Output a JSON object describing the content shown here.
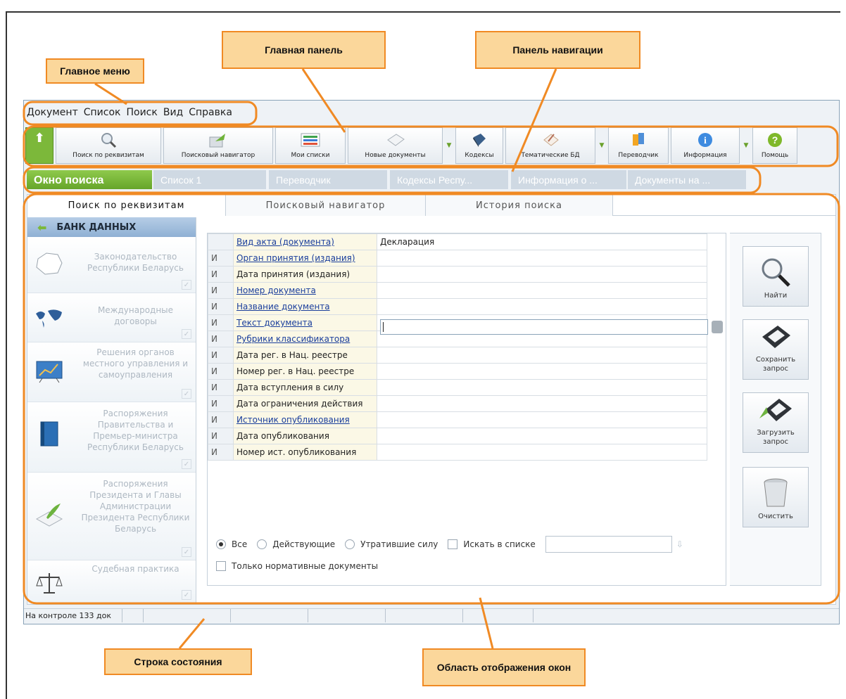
{
  "callouts": {
    "main_menu": "Главное меню",
    "main_panel": "Главная панель",
    "nav_panel": "Панель навигации",
    "status_bar": "Строка состояния",
    "window_area": "Область отображения окон"
  },
  "menu": [
    "Документ",
    "Список",
    "Поиск",
    "Вид",
    "Справка"
  ],
  "toolbar": [
    {
      "label": "Поиск по реквизитам",
      "icon": "magnifier-icon"
    },
    {
      "label": "Поисковый навигатор",
      "icon": "navigator-arrow-icon"
    },
    {
      "label": "Мои списки",
      "icon": "lists-icon"
    },
    {
      "label": "Новые документы",
      "icon": "new-documents-icon"
    },
    {
      "label": "Кодексы",
      "icon": "codex-book-icon"
    },
    {
      "label": "Тематические БД",
      "icon": "thematic-db-icon"
    },
    {
      "label": "Переводчик",
      "icon": "translator-icon"
    },
    {
      "label": "Информация",
      "icon": "info-icon"
    },
    {
      "label": "Помощь",
      "icon": "help-icon"
    }
  ],
  "window_tabs": [
    "Окно поиска",
    "Список 1",
    "Переводчик",
    "Кодексы Респу...",
    "Информация о ...",
    "Документы на ..."
  ],
  "search_tabs": [
    "Поиск по реквизитам",
    "Поисковый навигатор",
    "История поиска"
  ],
  "bank": {
    "title": "БАНК ДАННЫХ",
    "items": [
      "Законодательство Республики Беларусь",
      "Международные договоры",
      "Решения органов местного управления и самоуправления",
      "Распоряжения Правительства и Премьер-министра Республики Беларусь",
      "Распоряжения Президента и Главы Администрации Президента Республики Беларусь",
      "Судебная практика"
    ]
  },
  "requisites": [
    {
      "op": "",
      "name": "Вид акта (документа)",
      "value": "Декларация",
      "link": true
    },
    {
      "op": "И",
      "name": "Орган принятия (издания)",
      "value": "",
      "link": true
    },
    {
      "op": "И",
      "name": "Дата принятия (издания)",
      "value": "",
      "link": false
    },
    {
      "op": "И",
      "name": "Номер документа",
      "value": "",
      "link": true
    },
    {
      "op": "И",
      "name": "Название документа",
      "value": "",
      "link": true
    },
    {
      "op": "И",
      "name": "Текст документа",
      "value": "",
      "link": true
    },
    {
      "op": "И",
      "name": "Рубрики классификатора",
      "value": "",
      "link": true
    },
    {
      "op": "И",
      "name": "Дата рег. в Нац. реестре",
      "value": "",
      "link": false
    },
    {
      "op": "И",
      "name": "Номер рег. в Нац. реестре",
      "value": "",
      "link": false
    },
    {
      "op": "И",
      "name": "Дата вступления в силу",
      "value": "",
      "link": false
    },
    {
      "op": "И",
      "name": "Дата ограничения действия",
      "value": "",
      "link": false
    },
    {
      "op": "И",
      "name": "Источник опубликования",
      "value": "",
      "link": true
    },
    {
      "op": "И",
      "name": "Дата опубликования",
      "value": "",
      "link": false
    },
    {
      "op": "И",
      "name": "Номер ист. опубликования",
      "value": "",
      "link": false
    }
  ],
  "filters": {
    "all": "Все",
    "active": "Действующие",
    "expired": "Утратившие силу",
    "in_list": "Искать в списке",
    "normative_only": "Только нормативные документы"
  },
  "actions": {
    "find": "Найти",
    "save": "Сохранить запрос",
    "load": "Загрузить запрос",
    "clear": "Очистить"
  },
  "status": {
    "control": "На контроле 133 док"
  }
}
